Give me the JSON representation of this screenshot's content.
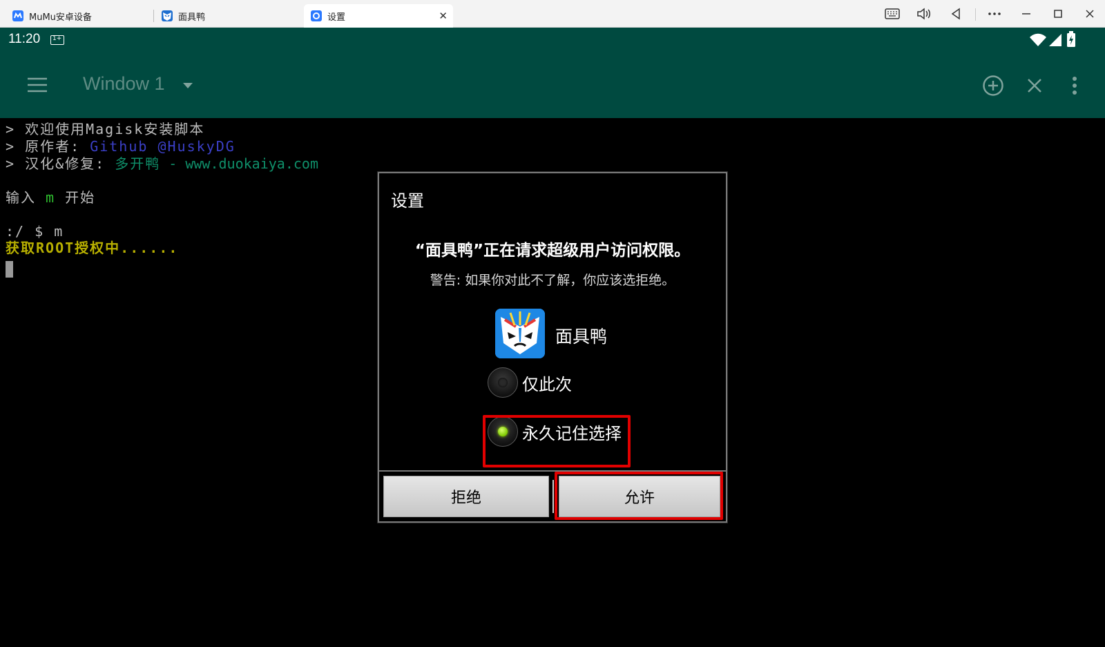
{
  "tabs": [
    {
      "label": "MuMu安卓设备",
      "icon": "mumu-icon",
      "active": false
    },
    {
      "label": "面具鸭",
      "icon": "mask-duck-icon",
      "active": false
    },
    {
      "label": "设置",
      "icon": "settings-icon",
      "active": true
    }
  ],
  "window_controls": [
    "keyboard-icon",
    "volume-icon",
    "back-icon",
    "more-icon",
    "minimize-icon",
    "maximize-icon",
    "close-icon"
  ],
  "status_bar": {
    "time": "11:20",
    "sim_label": "1+"
  },
  "toolbar": {
    "title": "Window 1"
  },
  "terminal": {
    "lines": [
      {
        "prefix": "> ",
        "text": "欢迎使用Magisk安装脚本",
        "highlight": "",
        "extra": ""
      },
      {
        "prefix": "> ",
        "text": "原作者: ",
        "highlight": "Github @HuskyDG",
        "extra": ""
      },
      {
        "prefix": "> ",
        "text": "汉化&修复: ",
        "highlight": "多开鸭",
        "extra": " - www.duokaiya.com"
      }
    ],
    "prompt_line": {
      "before": "输入 ",
      "key": "m",
      "after": " 开始"
    },
    "command": ":/ $ m",
    "status": "获取ROOT授权中......"
  },
  "dialog": {
    "title": "设置",
    "message": "“面具鸭”正在请求超级用户访问权限。",
    "warning": "警告: 如果你对此不了解，你应该选拒绝。",
    "app_name": "面具鸭",
    "options": [
      {
        "label": "仅此次",
        "selected": false
      },
      {
        "label": "永久记住选择",
        "selected": true
      }
    ],
    "deny_label": "拒绝",
    "allow_label": "允许"
  },
  "colors": {
    "toolbar_bg": "#004a40",
    "highlight_red": "#e10000",
    "link_blue": "#3b40c8",
    "link_teal": "#0f8f6a",
    "status_yellow": "#b8b000",
    "key_green": "#2fbf2f"
  }
}
